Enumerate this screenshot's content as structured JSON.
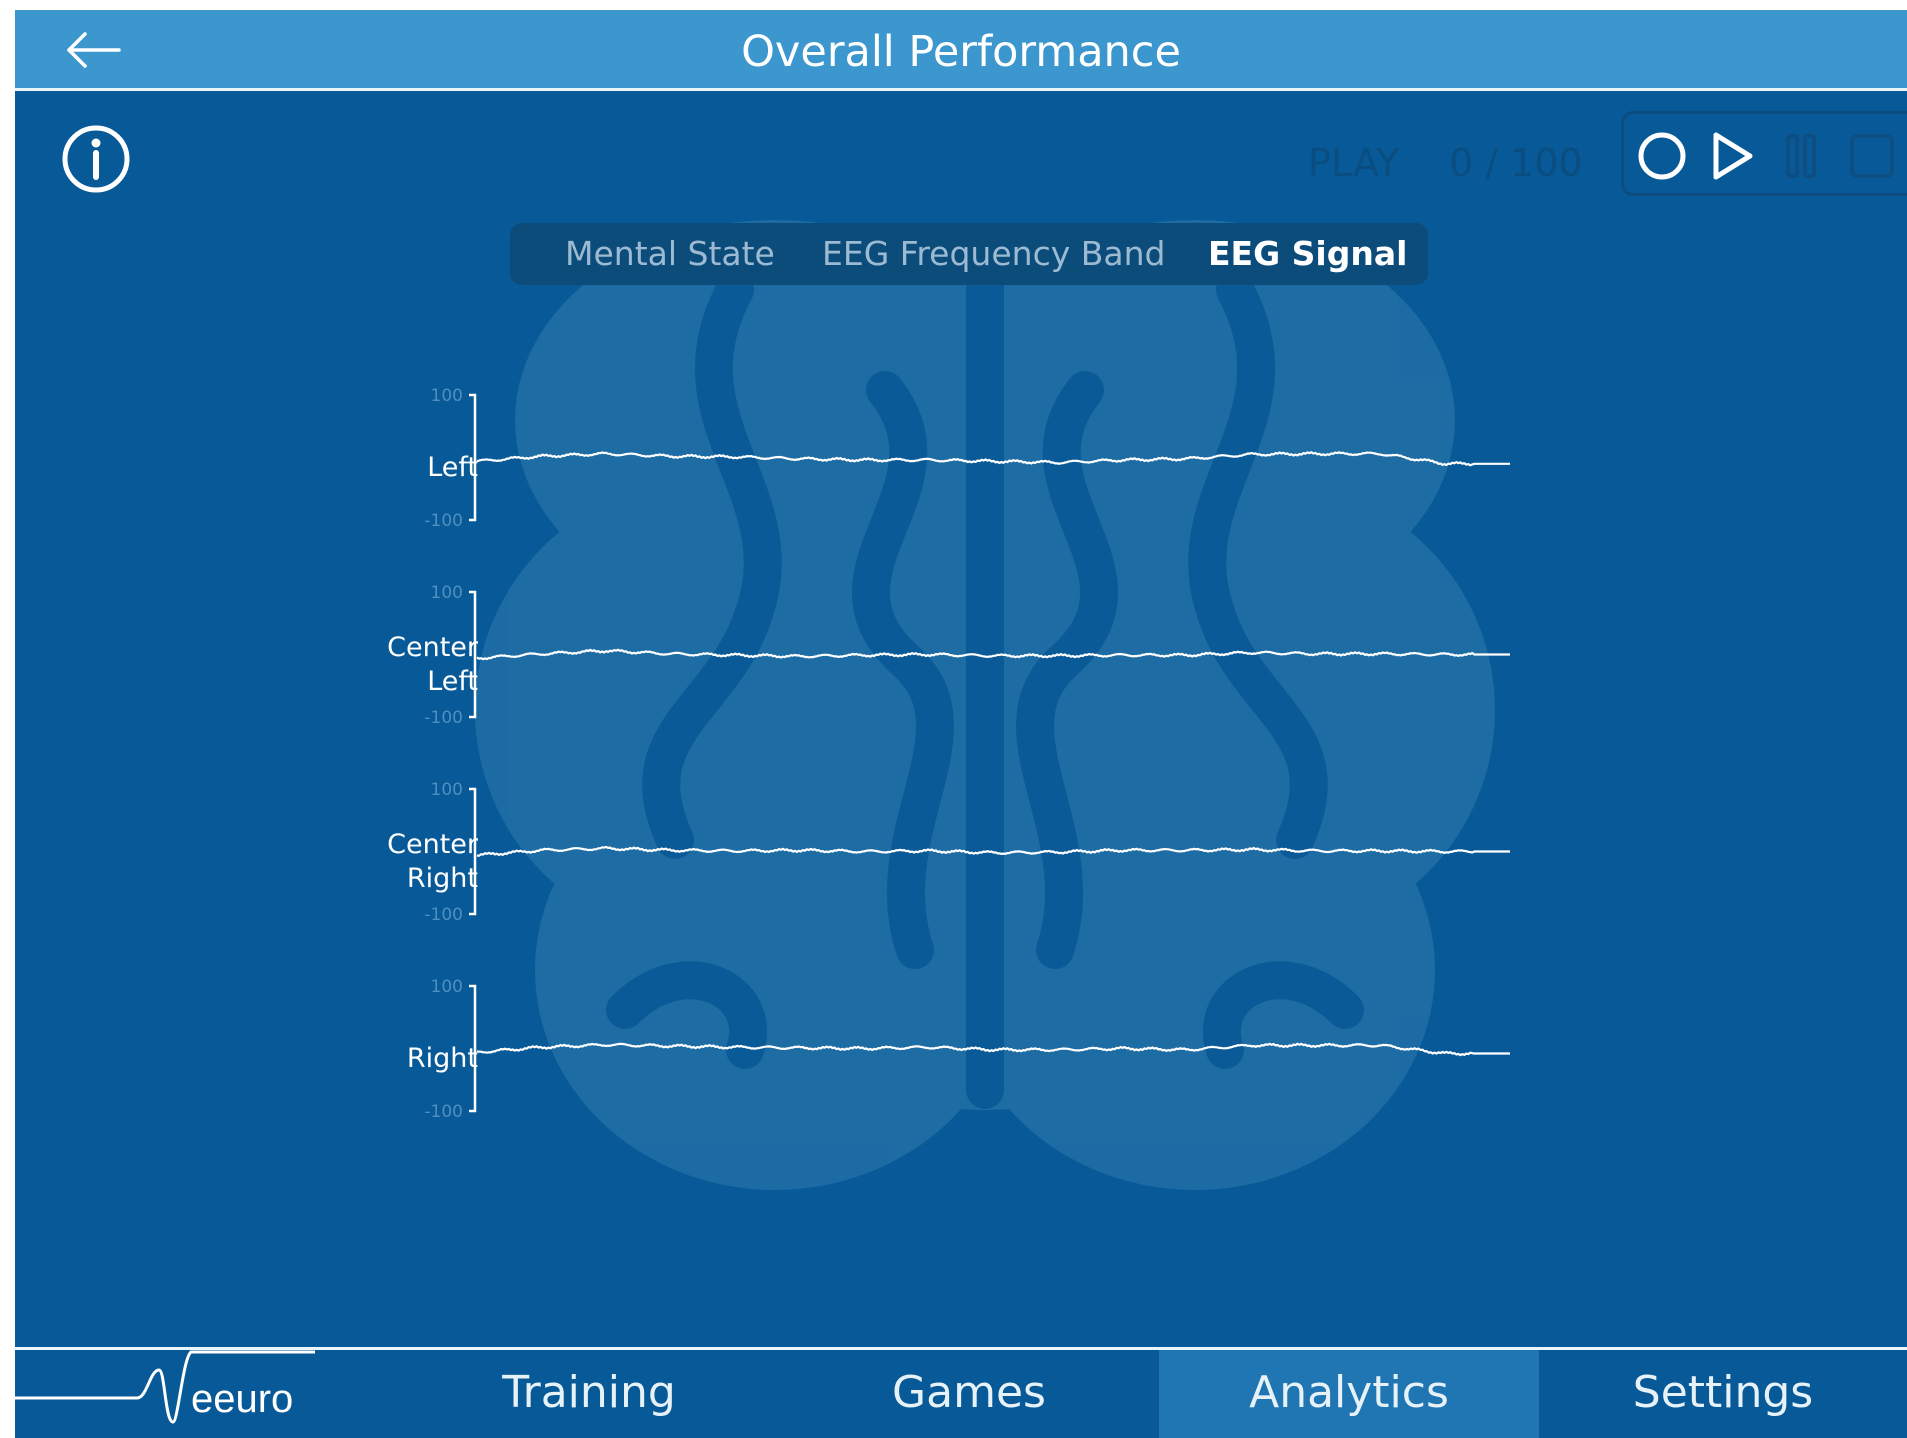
{
  "header": {
    "title": "Overall Performance",
    "back_icon": "arrow-left-icon",
    "info_icon": "info-circle-icon"
  },
  "playback": {
    "play_label": "PLAY",
    "count_text": "0 / 100",
    "controls": [
      {
        "name": "record-icon"
      },
      {
        "name": "play-icon"
      },
      {
        "name": "pause-icon"
      },
      {
        "name": "stop-icon"
      }
    ]
  },
  "tabs": [
    {
      "label": "Mental State",
      "active": false
    },
    {
      "label": "EEG Frequency Band",
      "active": false
    },
    {
      "label": "EEG Signal",
      "active": true
    }
  ],
  "chart_data": {
    "type": "line",
    "title": "",
    "ylim": [
      -100,
      100
    ],
    "yticks": [
      "100",
      "-100"
    ],
    "grid": false,
    "background_icon": "brain-icon",
    "series": [
      {
        "name": "Left",
        "label_lines": [
          "Left"
        ],
        "values": [
          -6,
          2,
          6,
          2,
          1,
          -2,
          -4,
          -4,
          -6,
          -8,
          -4,
          -2,
          5,
          6,
          6,
          -10,
          -10
        ]
      },
      {
        "name": "Center Left",
        "label_lines": [
          "Center",
          "Left"
        ],
        "values": [
          -6,
          1,
          6,
          1,
          -1,
          -3,
          -1,
          0,
          -2,
          -2,
          -1,
          -1,
          3,
          1,
          1,
          0,
          0
        ]
      },
      {
        "name": "Center Right",
        "label_lines": [
          "Center",
          "Right"
        ],
        "values": [
          -6,
          2,
          5,
          2,
          1,
          2,
          0,
          1,
          -2,
          -1,
          2,
          2,
          3,
          1,
          1,
          0,
          0
        ]
      },
      {
        "name": "Right",
        "label_lines": [
          "Right"
        ],
        "values": [
          -6,
          2,
          6,
          4,
          2,
          1,
          0,
          2,
          -2,
          -2,
          0,
          -2,
          5,
          5,
          5,
          -8,
          -8
        ]
      }
    ]
  },
  "bottom_nav": {
    "brand": "eeuro",
    "items": [
      {
        "label": "Training",
        "active": false
      },
      {
        "label": "Games",
        "active": false
      },
      {
        "label": "Analytics",
        "active": true
      },
      {
        "label": "Settings",
        "active": false
      }
    ]
  },
  "colors": {
    "background": "#075a97",
    "header": "#3b97ce",
    "active_nav": "#1f76b3",
    "signal": "#ffffff"
  }
}
